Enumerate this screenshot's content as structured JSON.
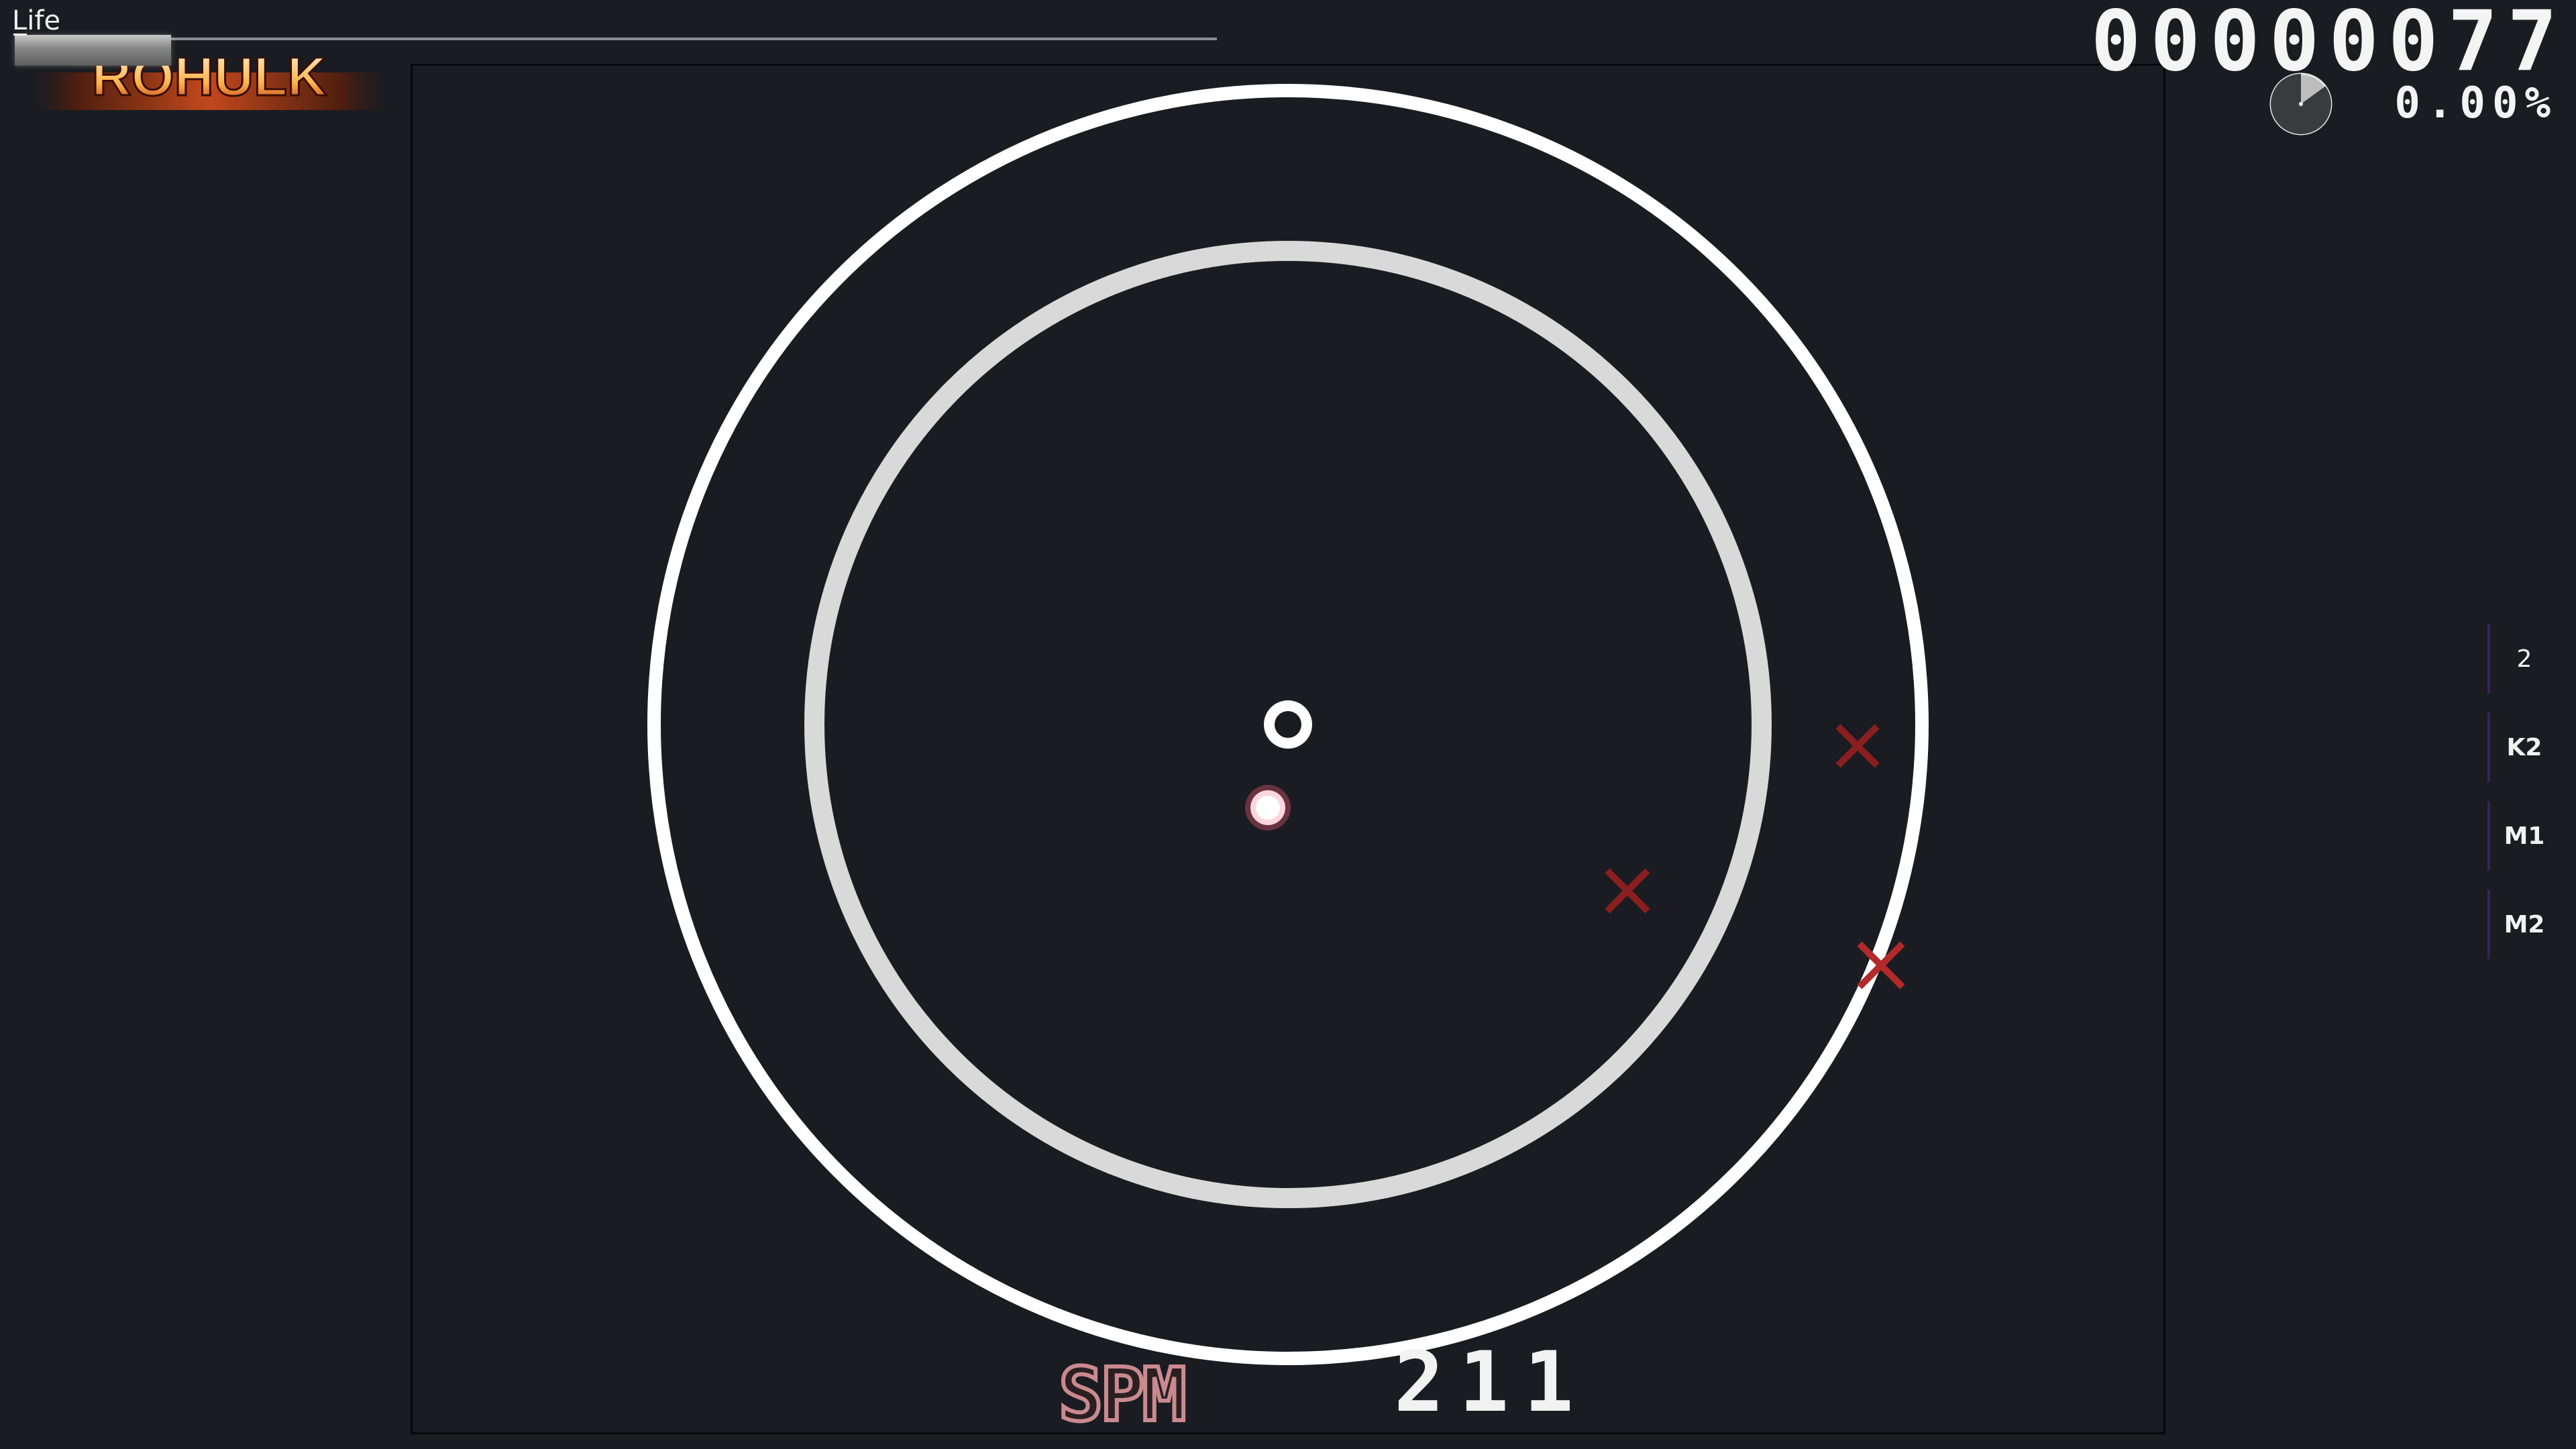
{
  "hud": {
    "life_label": "Life",
    "life_fraction": 0.13,
    "score": "00000077",
    "accuracy": "0.00%",
    "progress_fraction": 0.15,
    "spm_label": "SPM",
    "spm_value": "211"
  },
  "logo": {
    "text": "ROHULK"
  },
  "keys": [
    {
      "id": "count",
      "label": "2"
    },
    {
      "id": "k2",
      "label": "K2"
    },
    {
      "id": "m1",
      "label": "M1"
    },
    {
      "id": "m2",
      "label": "M2"
    }
  ],
  "colors": {
    "background": "#1a1c21",
    "ring_outer": "#ffffff",
    "ring_inner": "#d9d9d9",
    "miss_mark": "#8a1f1f",
    "cursor": "#ffd6dc",
    "key_bar": "#3b2060"
  },
  "icons": {
    "miss": "miss-x-icon",
    "cursor": "cursor-dot-icon",
    "spinner_center": "spinner-center-icon"
  }
}
